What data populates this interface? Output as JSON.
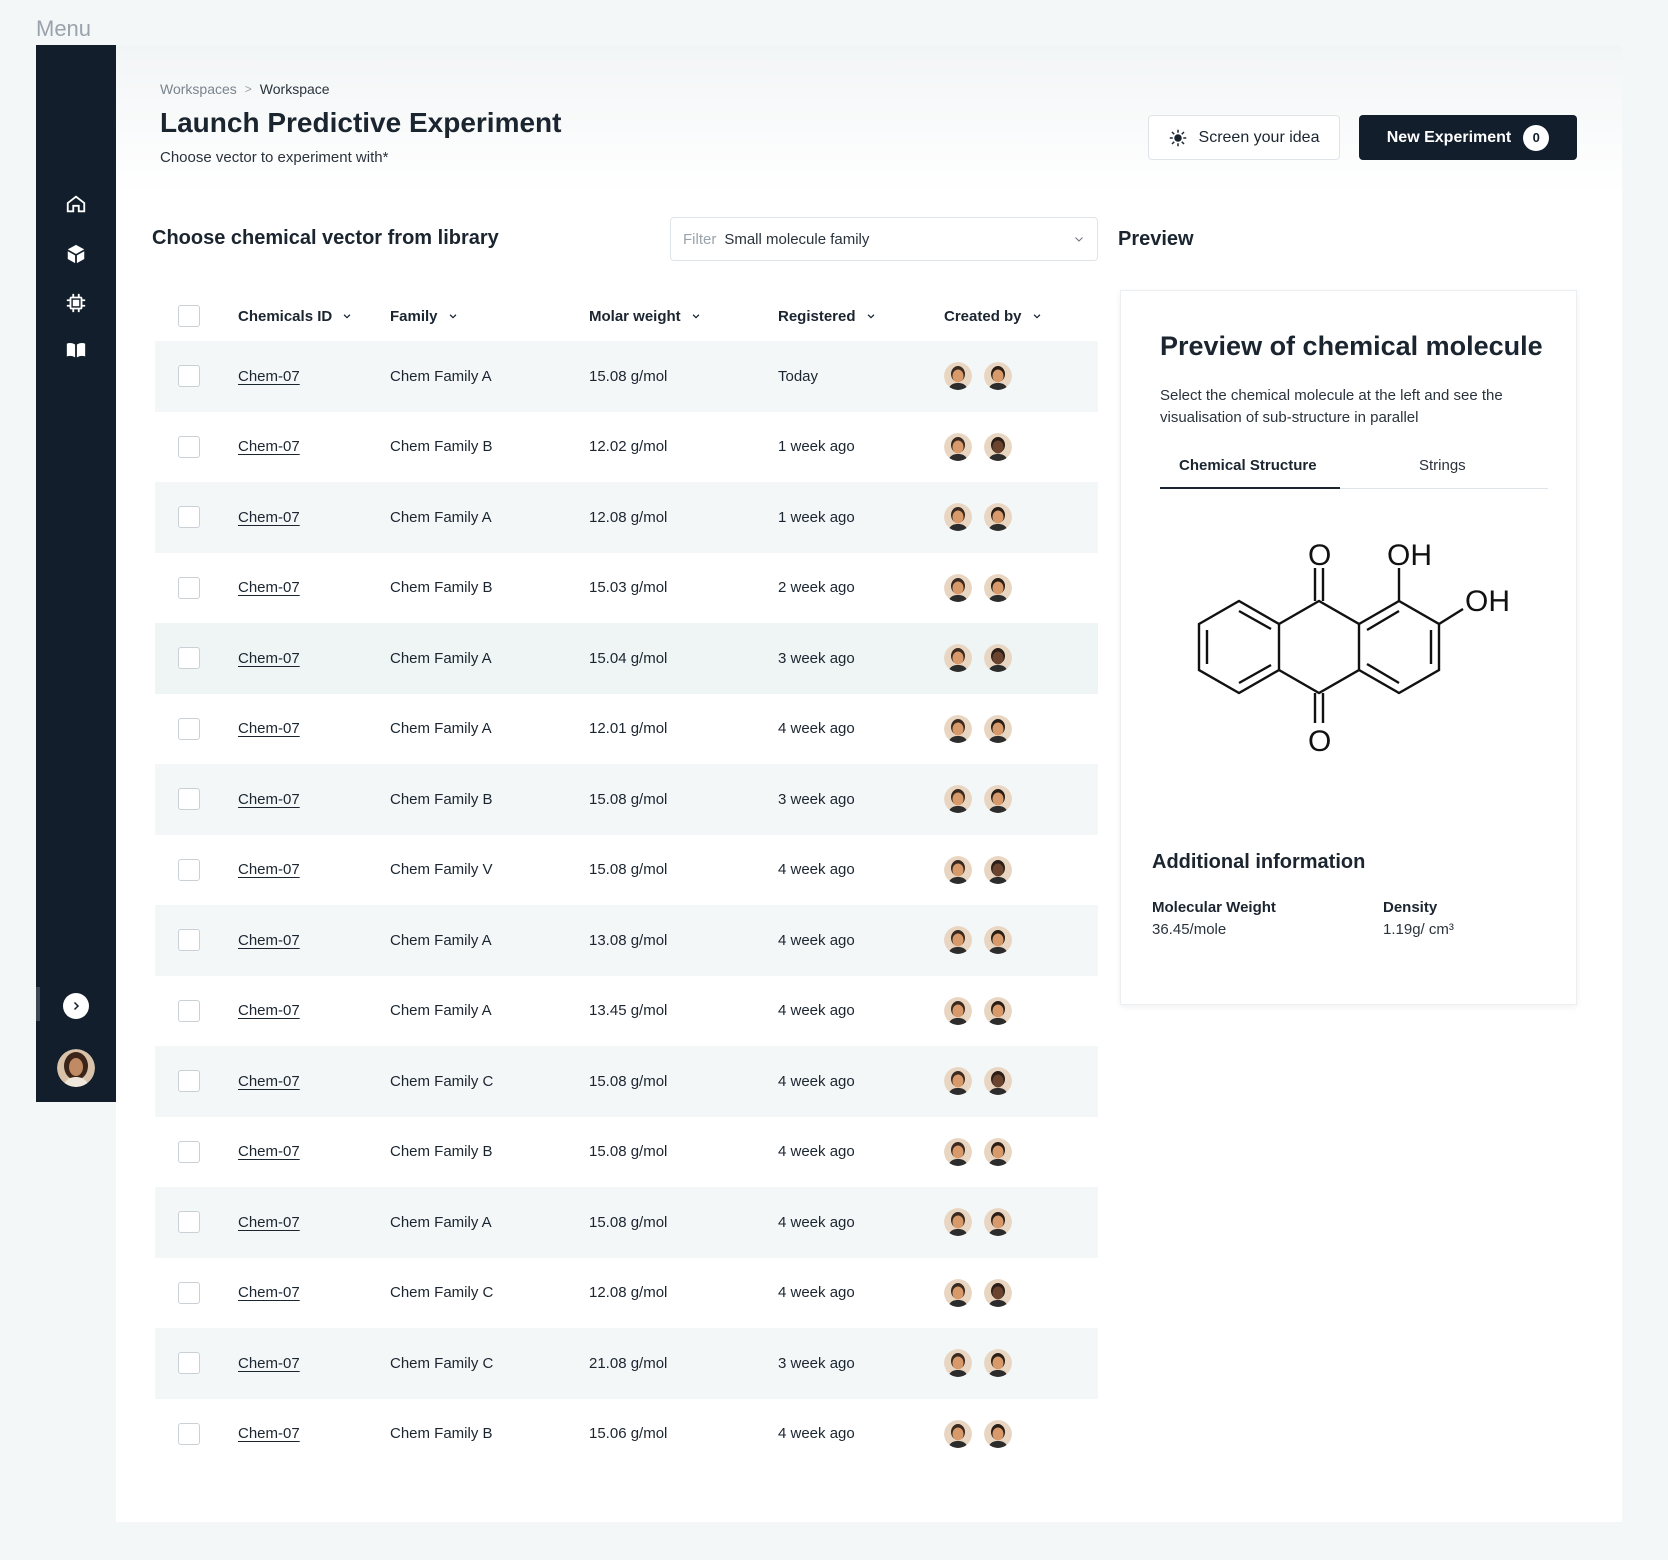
{
  "menu_label": "Menu",
  "breadcrumb": {
    "parent": "Workspaces",
    "separator": ">",
    "current": "Workspace"
  },
  "page": {
    "title": "Launch Predictive Experiment",
    "subtitle": "Choose vector to experiment with*"
  },
  "actions": {
    "screen_label": "Screen your idea",
    "new_label": "New Experiment",
    "new_count": "0"
  },
  "library": {
    "title": "Choose chemical vector from library"
  },
  "filter": {
    "label": "Filter",
    "value": "Small molecule family"
  },
  "table": {
    "headers": {
      "id": "Chemicals ID",
      "family": "Family",
      "molar": "Molar weight",
      "registered": "Registered",
      "created": "Created by"
    },
    "rows": [
      {
        "id": "Chem-07",
        "family": "Chem Family A",
        "molar": "15.08 g/mol",
        "registered": "Today"
      },
      {
        "id": "Chem-07",
        "family": "Chem Family B",
        "molar": "12.02 g/mol",
        "registered": "1 week ago"
      },
      {
        "id": "Chem-07",
        "family": "Chem Family A",
        "molar": "12.08 g/mol",
        "registered": "1 week ago"
      },
      {
        "id": "Chem-07",
        "family": "Chem Family B",
        "molar": "15.03 g/mol",
        "registered": "2 week ago"
      },
      {
        "id": "Chem-07",
        "family": "Chem Family A",
        "molar": "15.04 g/mol",
        "registered": "3 week ago"
      },
      {
        "id": "Chem-07",
        "family": "Chem Family A",
        "molar": "12.01 g/mol",
        "registered": "4 week ago"
      },
      {
        "id": "Chem-07",
        "family": "Chem Family B",
        "molar": "15.08 g/mol",
        "registered": "3 week ago"
      },
      {
        "id": "Chem-07",
        "family": "Chem Family V",
        "molar": "15.08 g/mol",
        "registered": "4 week ago"
      },
      {
        "id": "Chem-07",
        "family": "Chem Family A",
        "molar": "13.08 g/mol",
        "registered": "4 week ago"
      },
      {
        "id": "Chem-07",
        "family": "Chem Family A",
        "molar": "13.45 g/mol",
        "registered": "4 week ago"
      },
      {
        "id": "Chem-07",
        "family": "Chem Family C",
        "molar": "15.08 g/mol",
        "registered": "4 week ago"
      },
      {
        "id": "Chem-07",
        "family": "Chem Family B",
        "molar": "15.08 g/mol",
        "registered": "4 week ago"
      },
      {
        "id": "Chem-07",
        "family": "Chem Family A",
        "molar": "15.08 g/mol",
        "registered": "4 week ago"
      },
      {
        "id": "Chem-07",
        "family": "Chem Family C",
        "molar": "12.08 g/mol",
        "registered": "4 week ago"
      },
      {
        "id": "Chem-07",
        "family": "Chem Family C",
        "molar": "21.08 g/mol",
        "registered": "3 week ago"
      },
      {
        "id": "Chem-07",
        "family": "Chem Family B",
        "molar": "15.06 g/mol",
        "registered": "4 week ago"
      }
    ]
  },
  "preview": {
    "heading": "Preview",
    "card_title": "Preview of chemical molecule",
    "description": "Select the chemical molecule at the left and see the visualisation of sub-structure in parallel",
    "tabs": [
      "Chemical Structure",
      "Strings"
    ],
    "molecule_labels": {
      "o_top": "O",
      "oh1": "OH",
      "oh2": "OH",
      "o_bottom": "O"
    },
    "additional_title": "Additional information",
    "mw_label": "Molecular Weight",
    "mw_value": "36.45/mole",
    "density_label": "Density",
    "density_value": "1.19g/ cm³"
  },
  "colors": {
    "sidebar": "#121e2b",
    "primary_button": "#121e2b",
    "row_stripe": "#f4f7f8"
  }
}
